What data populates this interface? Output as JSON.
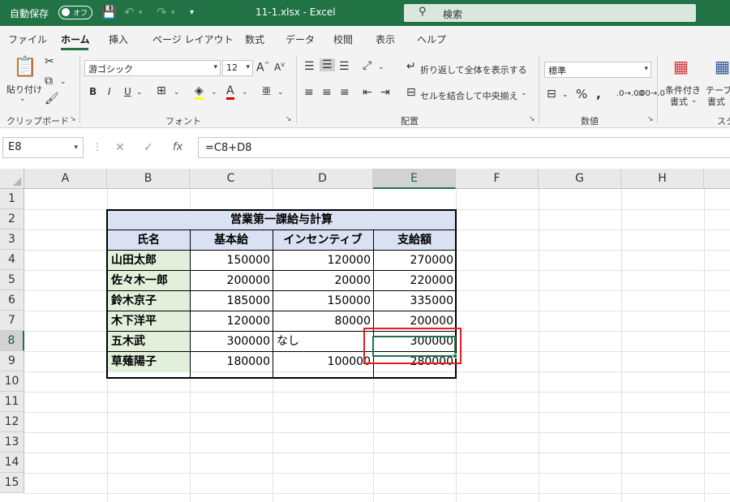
{
  "titlebar": {
    "autosave_label": "自動保存",
    "autosave_state": "オフ",
    "doc_title": "11-1.xlsx  -  Excel",
    "search_placeholder": "検索"
  },
  "tabs": [
    "ファイル",
    "ホーム",
    "挿入",
    "ページ レイアウト",
    "数式",
    "データ",
    "校閲",
    "表示",
    "ヘルプ"
  ],
  "active_tab": "ホーム",
  "ribbon": {
    "clipboard": {
      "paste": "貼り付け",
      "label": "クリップボード"
    },
    "font": {
      "name": "游ゴシック",
      "size": "12",
      "label": "フォント"
    },
    "alignment": {
      "wrap": "折り返して全体を表示する",
      "merge": "セルを結合して中央揃え",
      "label": "配置"
    },
    "number": {
      "format": "標準",
      "label": "数値"
    },
    "styles": {
      "conditional_1": "条件付き",
      "conditional_2": "書式",
      "table_1": "テーブル",
      "table_2": "書式",
      "label": "スタ"
    }
  },
  "formula_bar": {
    "name_box": "E8",
    "formula": "=C8+D8"
  },
  "columns": [
    "A",
    "B",
    "C",
    "D",
    "E",
    "F",
    "G",
    "H"
  ],
  "rows": [
    "1",
    "2",
    "3",
    "4",
    "5",
    "6",
    "7",
    "8",
    "9",
    "10",
    "11",
    "12",
    "13",
    "14",
    "15"
  ],
  "selected_column": "E",
  "selected_row": "8",
  "sheet": {
    "title": "営業第一課給与計算",
    "headers": [
      "氏名",
      "基本給",
      "インセンティブ",
      "支給額"
    ],
    "data": [
      [
        "山田太郎",
        "150000",
        "120000",
        "270000"
      ],
      [
        "佐々木一郎",
        "200000",
        "20000",
        "220000"
      ],
      [
        "鈴木京子",
        "185000",
        "150000",
        "335000"
      ],
      [
        "木下洋平",
        "120000",
        "80000",
        "200000"
      ],
      [
        "五木武",
        "300000",
        "なし",
        "300000"
      ],
      [
        "草薙陽子",
        "180000",
        "100000",
        "280000"
      ]
    ]
  },
  "colors": {
    "excel_green": "#217346",
    "header_fill": "#d9e1f2",
    "name_fill": "#e2efda",
    "highlight_box": "#e02020"
  }
}
